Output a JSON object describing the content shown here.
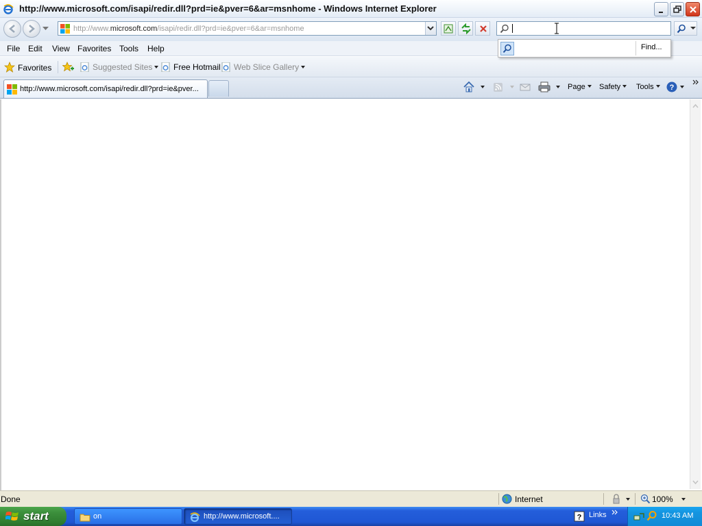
{
  "window": {
    "title": "http://www.microsoft.com/isapi/redir.dll?prd=ie&pver=6&ar=msnhome - Windows Internet Explorer"
  },
  "address_bar": {
    "url_prefix": "http://www.",
    "url_domain": "microsoft.com",
    "url_path": "/isapi/redir.dll?prd=ie&pver=6&ar=msnhome"
  },
  "search": {
    "value": "",
    "suggest_find_label": "Find..."
  },
  "menu": [
    "File",
    "Edit",
    "View",
    "Favorites",
    "Tools",
    "Help"
  ],
  "favorites_bar": {
    "favorites_label": "Favorites",
    "items": [
      "Suggested Sites",
      "Free Hotmail",
      "Web Slice Gallery"
    ]
  },
  "tab": {
    "title": "http://www.microsoft.com/isapi/redir.dll?prd=ie&pver..."
  },
  "command_bar": {
    "page": "Page",
    "safety": "Safety",
    "tools": "Tools"
  },
  "status_bar": {
    "status": "Done",
    "zone": "Internet",
    "zoom": "100%"
  },
  "taskbar": {
    "start_label": "start",
    "buttons": [
      "on",
      "http://www.microsoft...."
    ],
    "links_label": "Links",
    "clock": "10:43 AM"
  },
  "colors": {
    "taskbar": "#245edb",
    "start_button": "#3c8f3c",
    "tray": "#1495e0"
  }
}
